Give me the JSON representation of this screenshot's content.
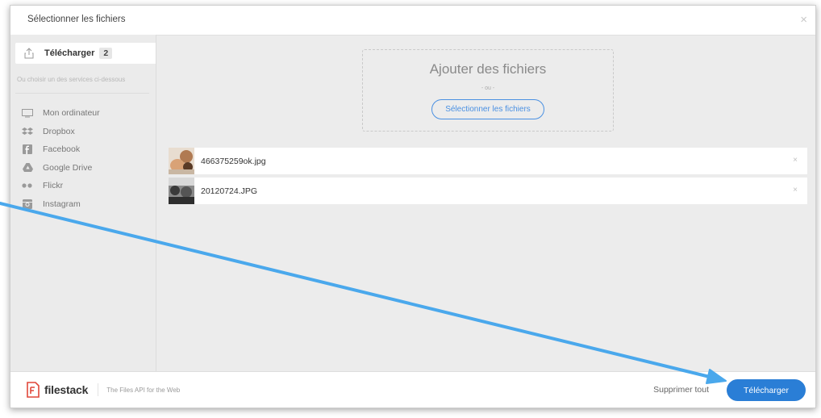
{
  "dialog": {
    "title": "Sélectionner les fichiers",
    "close_glyph": "×"
  },
  "sidebar": {
    "upload_tab": {
      "label": "Télécharger",
      "count": "2",
      "icon": "upload-icon"
    },
    "services_hint": "Ou choisir un des services ci-dessous",
    "sources": [
      {
        "label": "Mon ordinateur",
        "icon": "monitor-icon"
      },
      {
        "label": "Dropbox",
        "icon": "dropbox-icon"
      },
      {
        "label": "Facebook",
        "icon": "facebook-icon"
      },
      {
        "label": "Google Drive",
        "icon": "google-drive-icon"
      },
      {
        "label": "Flickr",
        "icon": "flickr-icon"
      },
      {
        "label": "Instagram",
        "icon": "instagram-icon"
      }
    ]
  },
  "dropzone": {
    "title": "Ajouter des fichiers",
    "or_text": "- ou -",
    "select_button": "Sélectionner les fichiers"
  },
  "files": [
    {
      "name": "466375259ok.jpg",
      "remove_glyph": "×"
    },
    {
      "name": "20120724.JPG",
      "remove_glyph": "×"
    }
  ],
  "footer": {
    "brand_name": "filestack",
    "brand_tagline": "The Files API for the Web",
    "remove_all_label": "Supprimer tout",
    "upload_button_label": "Télécharger"
  },
  "colors": {
    "accent": "#2a7ed6",
    "annotation_arrow": "#4aa8ec",
    "brand_red": "#e0473a"
  }
}
